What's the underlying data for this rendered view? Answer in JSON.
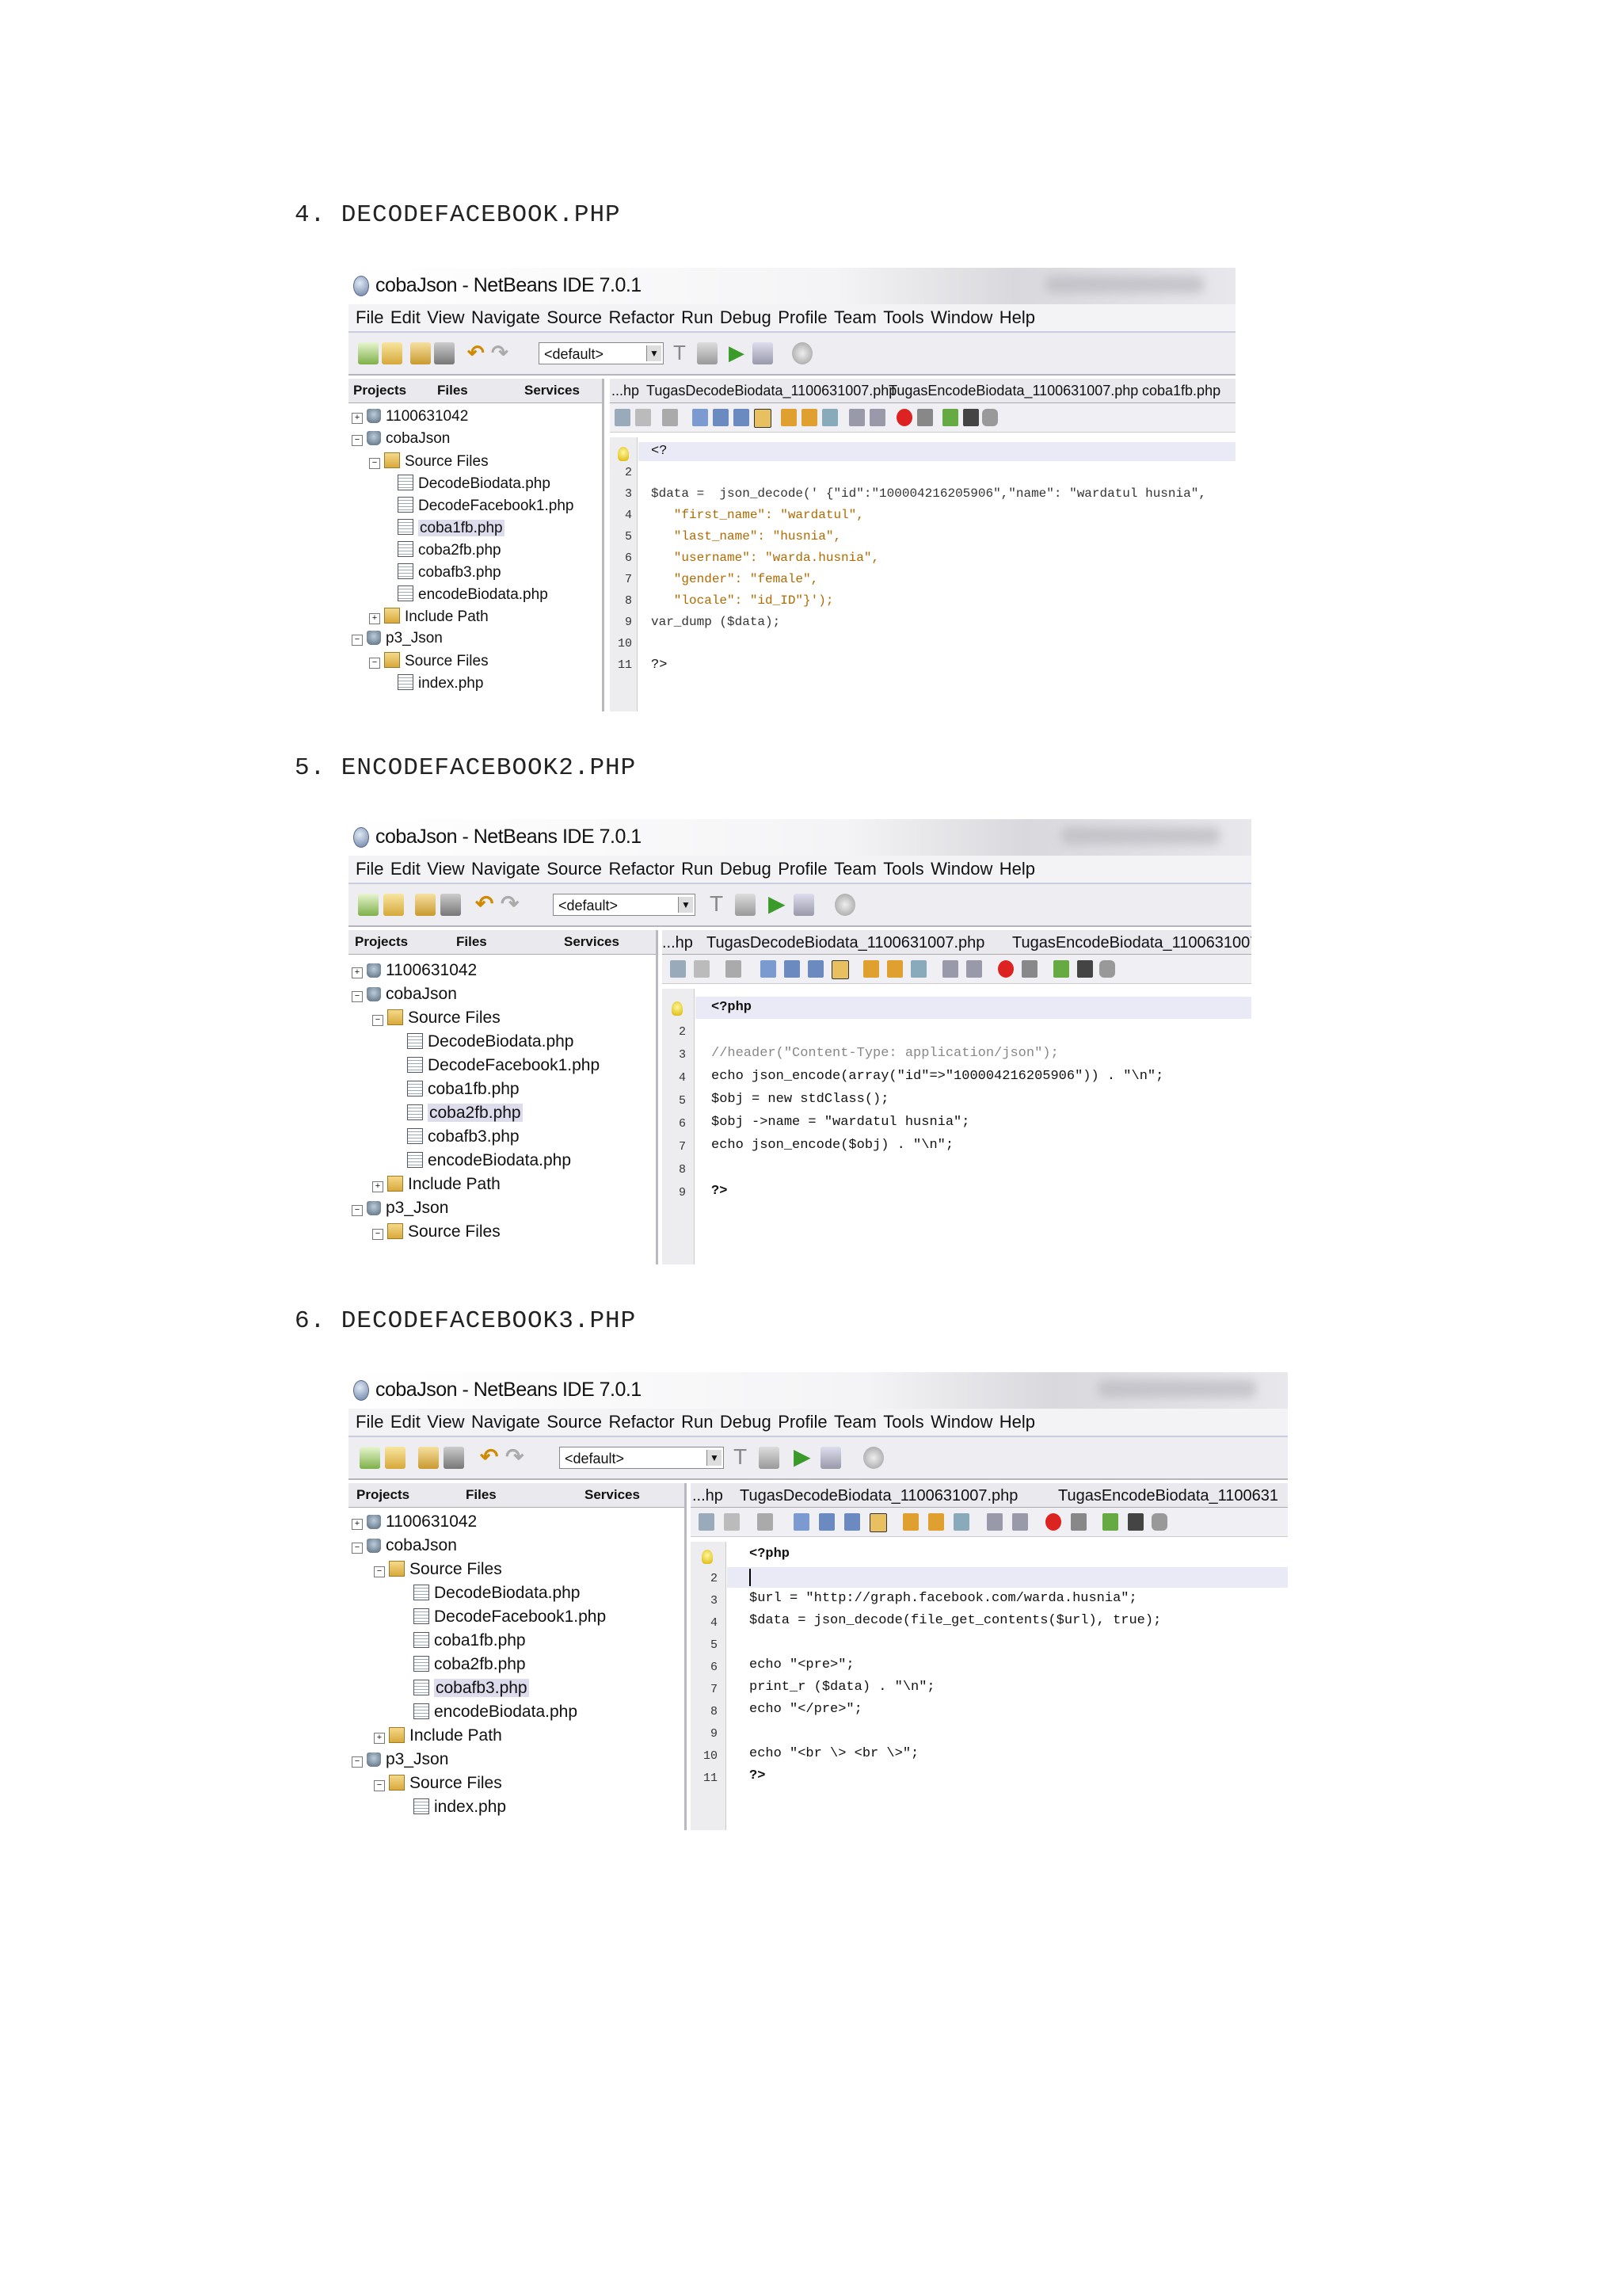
{
  "headings": [
    "4. DECODEFACEBOOK.PHP",
    "5. ENCODEFACEBOOK2.PHP",
    "6. DECODEFACEBOOK3.PHP"
  ],
  "window_title": "cobaJson - NetBeans IDE 7.0.1",
  "menu": [
    "File",
    "Edit",
    "View",
    "Navigate",
    "Source",
    "Refactor",
    "Run",
    "Debug",
    "Profile",
    "Team",
    "Tools",
    "Window",
    "Help"
  ],
  "config_combo": "<default>",
  "panel_tabs": [
    "Projects",
    "Files",
    "Services"
  ],
  "tree": {
    "p1": "1100631042",
    "p2": "cobaJson",
    "src": "Source Files",
    "f1": "DecodeBiodata.php",
    "f2": "DecodeFacebook1.php",
    "f3": "coba1fb.php",
    "f4": "coba2fb.php",
    "f5": "cobafb3.php",
    "f6": "encodeBiodata.php",
    "inc": "Include Path",
    "p3": "p3_Json",
    "src2": "Source Files",
    "f7": "index.php"
  },
  "editor_tabs": {
    "prev": "...hp",
    "t1": "TugasDecodeBiodata_1100631007.php",
    "t2": "TugasEncodeBiodata_1100631007.php",
    "t2_cut": "TugasEncodeBiodata_1100631007.ph",
    "t2_cut3": "TugasEncodeBiodata_1100631",
    "t3": "coba1fb.php"
  },
  "shot1_code": {
    "l1": "<?",
    "l2": "",
    "l3": "$data =  json_decode(' {\"id\":\"100004216205906\",\"name\": \"wardatul husnia\",",
    "l4": "   \"first_name\": \"wardatul\",",
    "l5": "   \"last_name\": \"husnia\",",
    "l6": "   \"username\": \"warda.husnia\",",
    "l7": "   \"gender\": \"female\",",
    "l8": "   \"locale\": \"id_ID\"}');",
    "l9": "var_dump ($data);",
    "l10": "",
    "l11": "?>"
  },
  "shot2_code": {
    "l1": "<?php",
    "l2": "",
    "l3": "//header(\"Content-Type: application/json\");",
    "l4": "echo json_encode(array(\"id\"=>\"100004216205906\")) . \"\\n\";",
    "l5": "$obj = new stdClass();",
    "l6": "$obj ->name = \"wardatul husnia\";",
    "l7": "echo json_encode($obj) . \"\\n\";",
    "l8": "",
    "l9": "?>"
  },
  "shot3_code": {
    "l1": "<?php",
    "l2": "",
    "l3": "$url = \"http://graph.facebook.com/warda.husnia\";",
    "l4": "$data = json_decode(file_get_contents($url), true);",
    "l5": "",
    "l6": "echo \"<pre>\";",
    "l7": "print_r ($data) . \"\\n\";",
    "l8": "echo \"</pre>\";",
    "l9": "",
    "l10": "echo \"<br \\> <br \\>\";",
    "l11": "?>"
  },
  "line_numbers": [
    "1",
    "2",
    "3",
    "4",
    "5",
    "6",
    "7",
    "8",
    "9",
    "10",
    "11"
  ]
}
